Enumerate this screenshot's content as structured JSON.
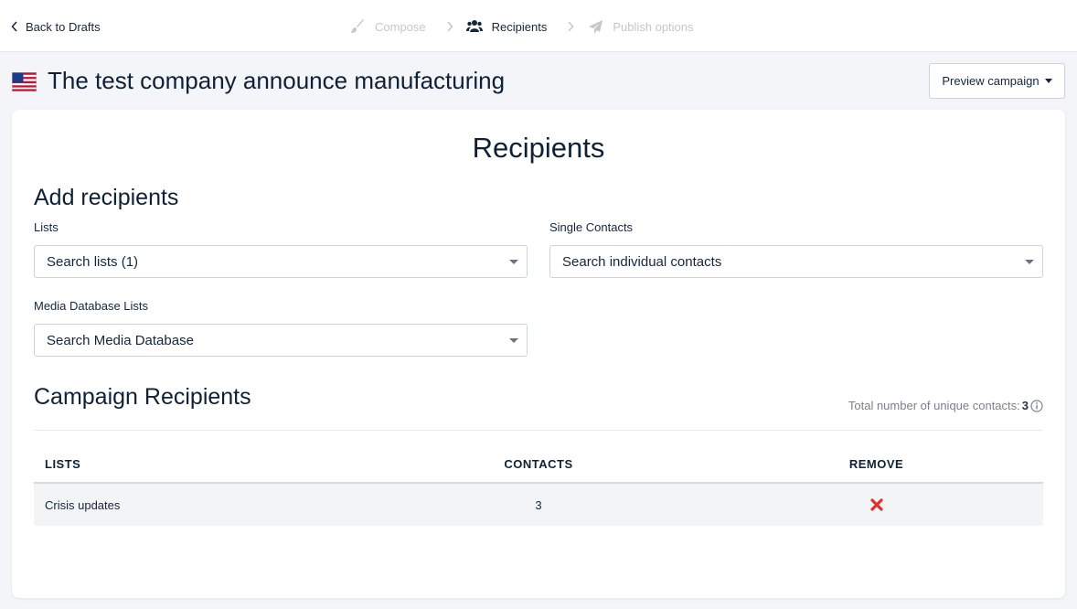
{
  "nav": {
    "back_label": "Back to Drafts",
    "steps": [
      {
        "label": "Compose",
        "icon": "brush-icon",
        "state": "disabled"
      },
      {
        "label": "Recipients",
        "icon": "users-icon",
        "state": "active"
      },
      {
        "label": "Publish options",
        "icon": "paper-plane-icon",
        "state": "disabled"
      }
    ]
  },
  "header": {
    "flag": "us-flag-icon",
    "title": "The test company announce manufacturing",
    "preview_label": "Preview campaign"
  },
  "card": {
    "heading": "Recipients",
    "add_section": {
      "title": "Add recipients",
      "lists_label": "Lists",
      "lists_placeholder": "Search lists (1)",
      "single_label": "Single Contacts",
      "single_placeholder": "Search individual contacts",
      "media_label": "Media Database Lists",
      "media_placeholder": "Search Media Database"
    },
    "campaign_section": {
      "title": "Campaign Recipients",
      "total_label": "Total number of unique contacts:",
      "total_value": "3",
      "columns": [
        "LISTS",
        "CONTACTS",
        "REMOVE"
      ],
      "rows": [
        {
          "list": "Crisis updates",
          "contacts": "3"
        }
      ]
    }
  },
  "colors": {
    "text": "#0f2136",
    "muted": "#c3c8cf",
    "remove": "#e03131",
    "row_bg": "#f3f4f6",
    "page_bg": "#f3f5f8"
  }
}
